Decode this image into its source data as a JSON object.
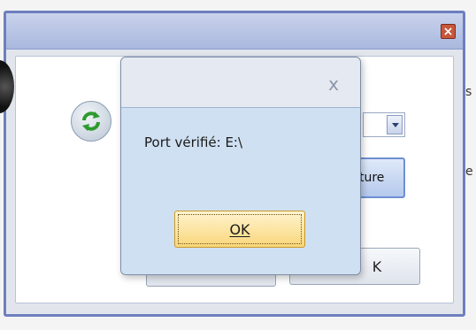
{
  "background_window": {
    "close_icon": "close-icon",
    "dropdown_icon": "chevron-down-icon",
    "fermeture_label": "ture",
    "cancel_label": "K",
    "edge_text_1": "s",
    "edge_text_2": "e"
  },
  "dialog": {
    "close_glyph": "x",
    "message": "Port vérifié: E:\\",
    "ok_label": "OK"
  },
  "colors": {
    "accent": "#6e7fbf",
    "ok_button": "#f9d67a",
    "dialog_body": "#cfe0f2"
  }
}
